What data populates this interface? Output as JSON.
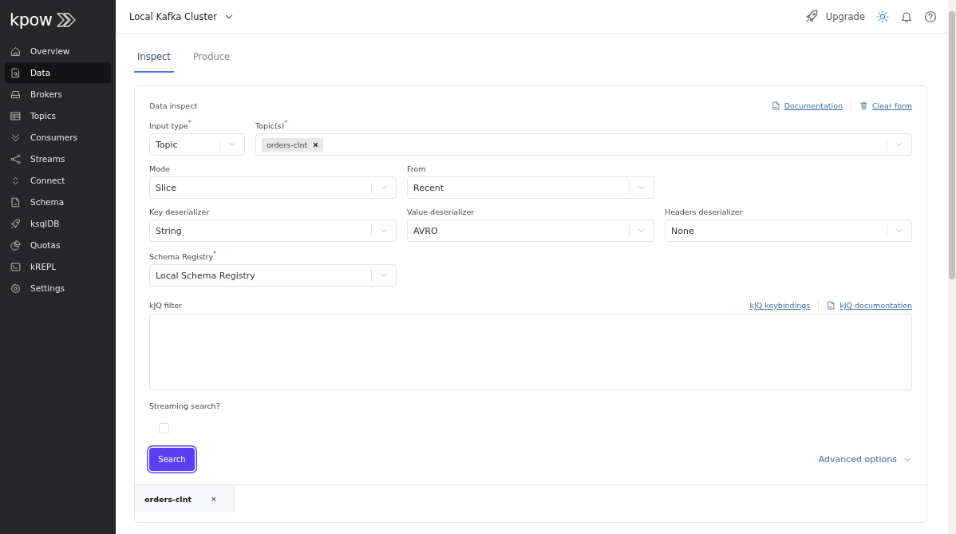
{
  "brand": {
    "name": "kpow"
  },
  "sidebar": {
    "items": [
      {
        "label": "Overview",
        "selected": false
      },
      {
        "label": "Data",
        "selected": true
      },
      {
        "label": "Brokers",
        "selected": false
      },
      {
        "label": "Topics",
        "selected": false
      },
      {
        "label": "Consumers",
        "selected": false
      },
      {
        "label": "Streams",
        "selected": false
      },
      {
        "label": "Connect",
        "selected": false
      },
      {
        "label": "Schema",
        "selected": false
      },
      {
        "label": "ksqlDB",
        "selected": false
      },
      {
        "label": "Quotas",
        "selected": false
      },
      {
        "label": "kREPL",
        "selected": false
      },
      {
        "label": "Settings",
        "selected": false
      }
    ]
  },
  "header": {
    "cluster": "Local Kafka Cluster",
    "upgrade": "Upgrade"
  },
  "tabs": [
    {
      "label": "Inspect",
      "selected": true
    },
    {
      "label": "Produce",
      "selected": false
    }
  ],
  "form": {
    "title": "Data inspect",
    "links": [
      {
        "label": "Documentation"
      },
      {
        "label": "Clear form"
      }
    ],
    "rows": [
      [
        {
          "kind": "select",
          "label": "Input type$^{*}$",
          "value": "Topic"
        },
        {
          "kind": "multi",
          "label": "Topic(s)$^{*}$",
          "tags": [
            "orders-clnt"
          ]
        }
      ],
      [
        {
          "kind": "select",
          "label": "Mode",
          "value": "Slice"
        },
        {
          "kind": "select",
          "label": "From",
          "value": "Recent"
        }
      ],
      [
        {
          "kind": "select",
          "label": "Key deserializer",
          "value": "String"
        },
        {
          "kind": "select",
          "label": "Value deserializer",
          "value": "AVRO"
        },
        {
          "kind": "select",
          "label": "Headers deserializer",
          "value": "None"
        }
      ],
      [
        {
          "kind": "select",
          "label": "Schema Registry$^{*}$",
          "value": "Local Schema Registry"
        }
      ]
    ],
    "filter": {
      "label": "kJQ filter",
      "links": [
        {
          "label": "kJQ keybindings"
        },
        {
          "label": "kJQ documentation"
        }
      ]
    },
    "streaming": {
      "label": "Streaming search?",
      "checked": false
    },
    "search_button": {
      "label": "Search",
      "focused": true
    },
    "advanced": {
      "label": "Advanced options",
      "expanded": false
    }
  },
  "result_tabs": [
    {
      "label": "orders-clnt",
      "close": "×"
    }
  ]
}
